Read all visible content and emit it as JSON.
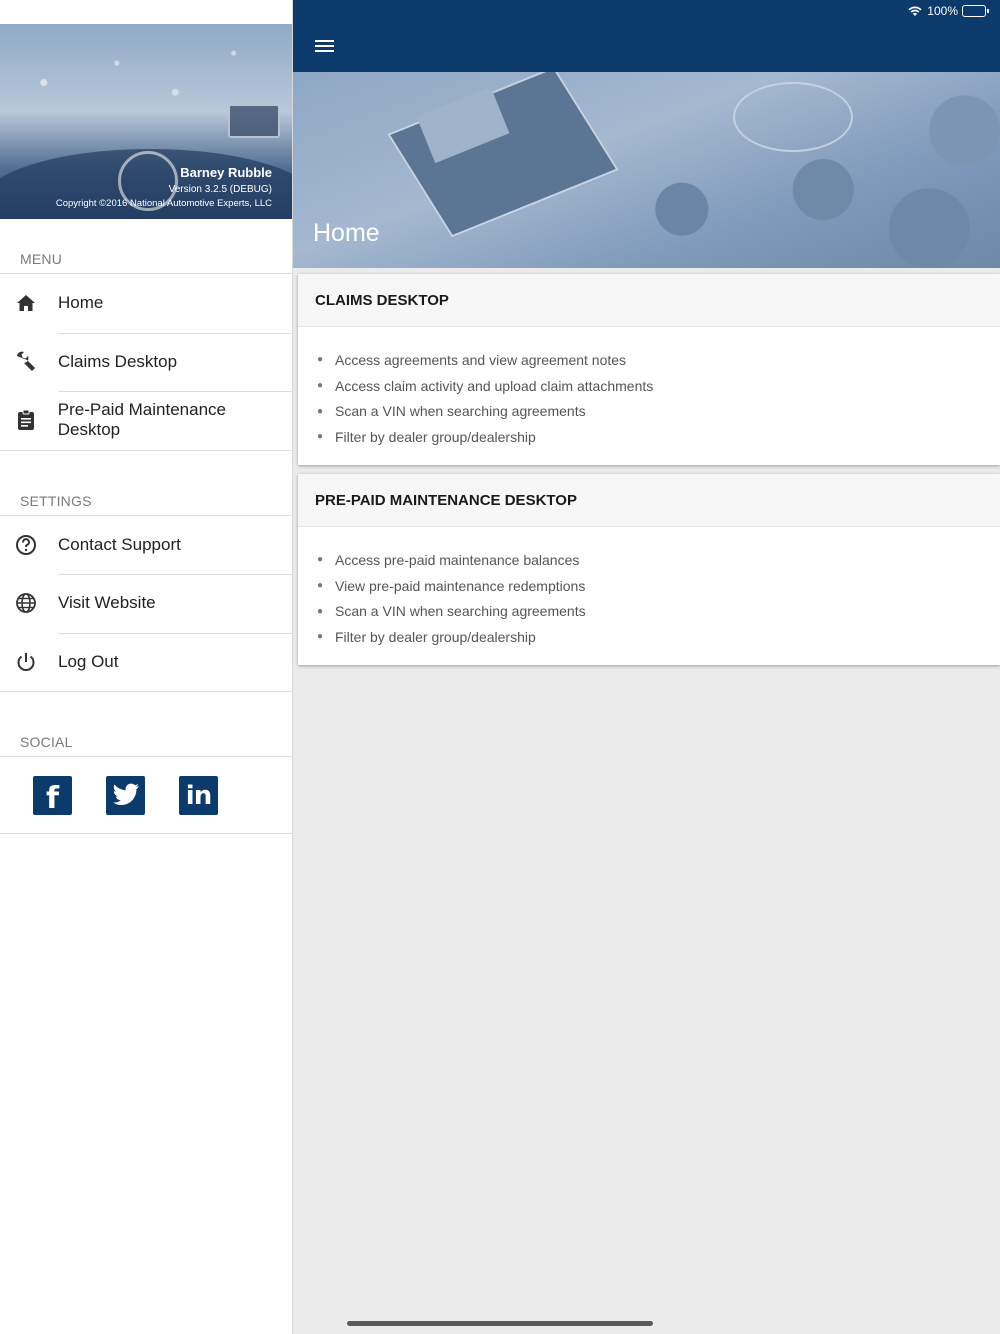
{
  "status_bar": {
    "battery": "100%",
    "icons": [
      "wifi-icon",
      "battery-icon"
    ]
  },
  "sidebar": {
    "user_name": "Barney Rubble",
    "version": "Version 3.2.5 (DEBUG)",
    "copyright": "Copyright ©2016 National Automotive Experts, LLC",
    "menu_header": "MENU",
    "menu_items": [
      {
        "label": "Home",
        "icon": "home-icon"
      },
      {
        "label": "Claims Desktop",
        "icon": "wrench-icon"
      },
      {
        "label": "Pre-Paid Maintenance Desktop",
        "icon": "clipboard-icon"
      }
    ],
    "settings_header": "SETTINGS",
    "settings_items": [
      {
        "label": "Contact Support",
        "icon": "help-circle-icon"
      },
      {
        "label": "Visit Website",
        "icon": "globe-icon"
      },
      {
        "label": "Log Out",
        "icon": "power-icon"
      }
    ],
    "social_header": "SOCIAL",
    "social": [
      {
        "name": "facebook",
        "icon": "facebook-icon",
        "glyph": "f"
      },
      {
        "name": "twitter",
        "icon": "twitter-icon",
        "glyph": ""
      },
      {
        "name": "linkedin",
        "icon": "linkedin-icon",
        "glyph": "in"
      }
    ]
  },
  "header": {
    "title": "Home"
  },
  "cards": [
    {
      "title": "CLAIMS DESKTOP",
      "items": [
        "Access agreements and view agreement notes",
        "Access claim activity and upload claim attachments",
        "Scan a VIN when searching agreements",
        "Filter by dealer group/dealership"
      ]
    },
    {
      "title": "PRE-PAID MAINTENANCE DESKTOP",
      "items": [
        "Access pre-paid maintenance balances",
        "View pre-paid maintenance redemptions",
        "Scan a VIN when searching agreements",
        "Filter by dealer group/dealership"
      ]
    }
  ],
  "colors": {
    "primary": "#0b3a6b",
    "background": "#ebebeb",
    "card_header": "#f7f7f7"
  }
}
